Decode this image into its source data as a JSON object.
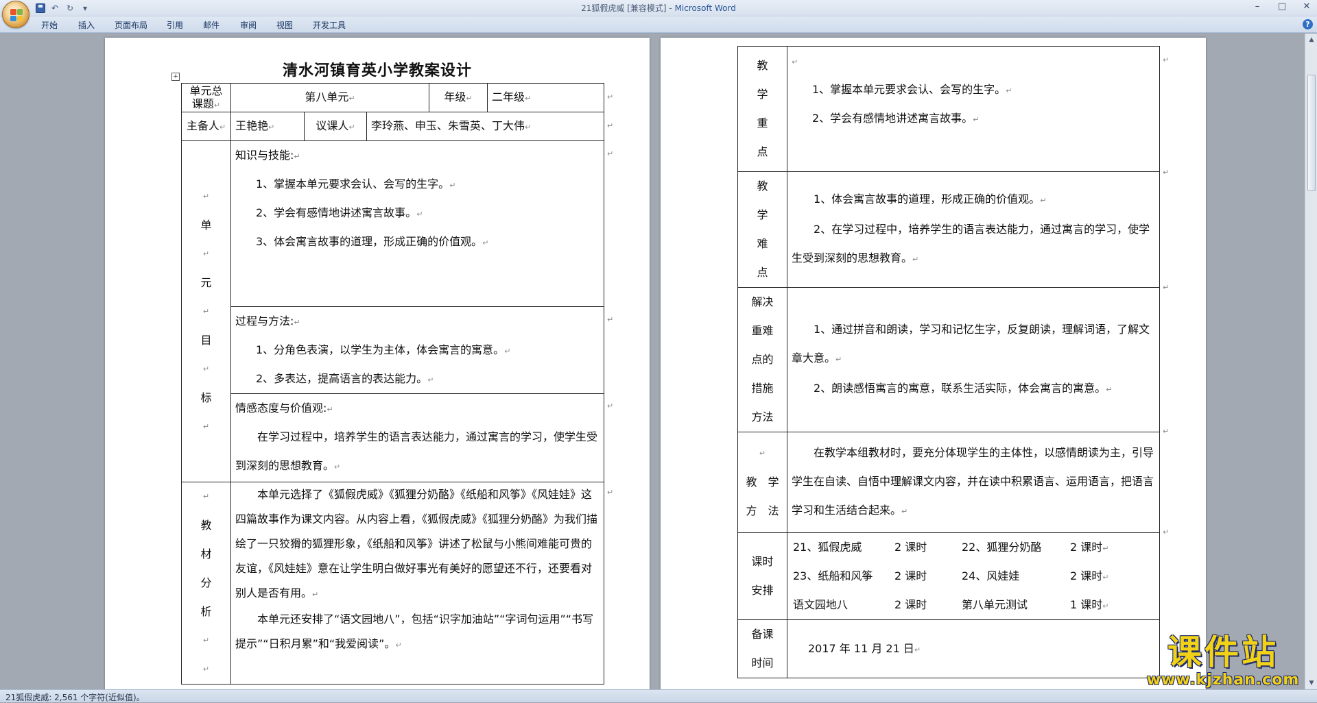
{
  "window": {
    "title": "21狐假虎威 [兼容模式] - ",
    "app_name": "Microsoft Word",
    "controls": [
      "–",
      "□",
      "✕"
    ]
  },
  "quick_access": {
    "undo": "↶",
    "redo": "↻",
    "more": "▾"
  },
  "ribbon_tabs": [
    "开始",
    "插入",
    "页面布局",
    "引用",
    "邮件",
    "审阅",
    "视图",
    "开发工具"
  ],
  "help": "?",
  "status_bar": {
    "text": "21狐假虎威: 2,561 个字符(近似值)。"
  },
  "watermark": {
    "brand": "课件站",
    "url": "www.kjzhan.com"
  },
  "para_mark": "↵",
  "page1": {
    "title": "清水河镇育英小学教案设计",
    "anchor": "+",
    "header": {
      "unit_label": "单元总课题",
      "unit_value": "第八单元",
      "grade_label": "年级",
      "grade_value": "二年级",
      "lead_label": "主备人",
      "lead_value": "王艳艳",
      "reviewers_label": "议课人",
      "reviewers_value": "李玲燕、申玉、朱雪英、丁大伟"
    },
    "goals_label": [
      "单",
      "元",
      "目",
      "标"
    ],
    "knowledge": {
      "heading": "知识与技能:",
      "items": [
        "1、掌握本单元要求会认、会写的生字。",
        "2、学会有感情地讲述寓言故事。",
        "3、体会寓言故事的道理，形成正确的价值观。"
      ]
    },
    "process": {
      "heading": "过程与方法:",
      "items": [
        "1、分角色表演，以学生为主体，体会寓言的寓意。",
        "2、多表达，提高语言的表达能力。"
      ]
    },
    "emotion": {
      "heading": "情感态度与价值观:",
      "text": "在学习过程中，培养学生的语言表达能力，通过寓言的学习，使学生受到深刻的思想教育。"
    },
    "analysis_label": [
      "教",
      "材",
      "分",
      "析"
    ],
    "analysis": [
      "本单元选择了《狐假虎威》《狐狸分奶酪》《纸船和风筝》《风娃娃》这四篇故事作为课文内容。从内容上看，《狐假虎威》《狐狸分奶酪》为我们描绘了一只狡猾的狐狸形象，《纸船和风筝》讲述了松鼠与小熊间难能可贵的友谊，《风娃娃》意在让学生明白做好事光有美好的愿望还不行，还要看对别人是否有用。",
      "本单元还安排了“语文园地八”，包括“识字加油站”“字词句运用”“书写提示”“日积月累”和“我爱阅读”。"
    ]
  },
  "page2": {
    "key_points": {
      "label": [
        "教",
        "学",
        "重",
        "点"
      ],
      "items": [
        "1、掌握本单元要求会认、会写的生字。",
        "2、学会有感情地讲述寓言故事。"
      ]
    },
    "difficulties": {
      "label": [
        "教",
        "学",
        "难",
        "点"
      ],
      "items": [
        "1、体会寓言故事的道理，形成正确的价值观。",
        "2、在学习过程中，培养学生的语言表达能力，通过寓言的学习，使学生受到深刻的思想教育。"
      ]
    },
    "measures": {
      "label": [
        "解决",
        "重难",
        "点的",
        "措施",
        "方法"
      ],
      "items": [
        "1、通过拼音和朗读，学习和记忆生字，反复朗读，理解词语，了解文章大意。",
        "2、朗读感悟寓言的寓意，联系生活实际，体会寓言的寓意。"
      ]
    },
    "methods": {
      "label": [
        "教　学",
        "方　法"
      ],
      "text": "在教学本组教材时，要充分体现学生的主体性，以感情朗读为主，引导学生在自读、自悟中理解课文内容，并在读中积累语言、运用语言，把语言学习和生活结合起来。"
    },
    "schedule": {
      "label": [
        "课时",
        "安排"
      ],
      "rows": [
        [
          {
            "name": "21、狐假虎威",
            "hours": "2 课时"
          },
          {
            "name": "22、狐狸分奶酪",
            "hours": "2 课时"
          }
        ],
        [
          {
            "name": "23、纸船和风筝",
            "hours": "2 课时"
          },
          {
            "name": "24、风娃娃",
            "hours": "2 课时"
          }
        ],
        [
          {
            "name": "语文园地八",
            "hours": "2 课时"
          },
          {
            "name": "第八单元测试",
            "hours": "1 课时"
          }
        ]
      ]
    },
    "prep_time": {
      "label": [
        "备课",
        "时间"
      ],
      "value": "2017 年 11 月 21 日"
    }
  }
}
